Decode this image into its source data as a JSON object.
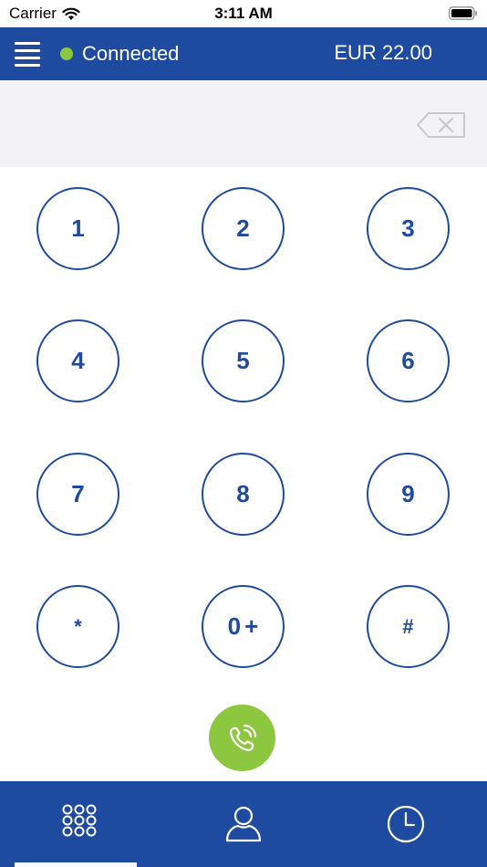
{
  "status_bar": {
    "carrier": "Carrier",
    "time": "3:11 AM"
  },
  "header": {
    "connection_status": "Connected",
    "balance": "EUR 22.00"
  },
  "dialer": {
    "entered_number": ""
  },
  "keypad": [
    {
      "digit": "1",
      "sub": ""
    },
    {
      "digit": "2",
      "sub": ""
    },
    {
      "digit": "3",
      "sub": ""
    },
    {
      "digit": "4",
      "sub": ""
    },
    {
      "digit": "5",
      "sub": ""
    },
    {
      "digit": "6",
      "sub": ""
    },
    {
      "digit": "7",
      "sub": ""
    },
    {
      "digit": "8",
      "sub": ""
    },
    {
      "digit": "9",
      "sub": ""
    },
    {
      "digit": "*",
      "sub": ""
    },
    {
      "digit": "0",
      "sub": "+"
    },
    {
      "digit": "#",
      "sub": ""
    }
  ],
  "icons": {
    "menu": "hamburger-menu-icon",
    "backspace": "backspace-icon",
    "call": "phone-call-icon",
    "tab_keypad": "keypad-grid-icon",
    "tab_contacts": "contact-person-icon",
    "tab_history": "clock-icon"
  },
  "colors": {
    "brand_blue": "#1e4aa0",
    "call_green": "#8dc63f",
    "connected_dot": "#8dc63f",
    "display_bg": "#f2f2f7"
  },
  "tabs": {
    "active_index": 0
  }
}
